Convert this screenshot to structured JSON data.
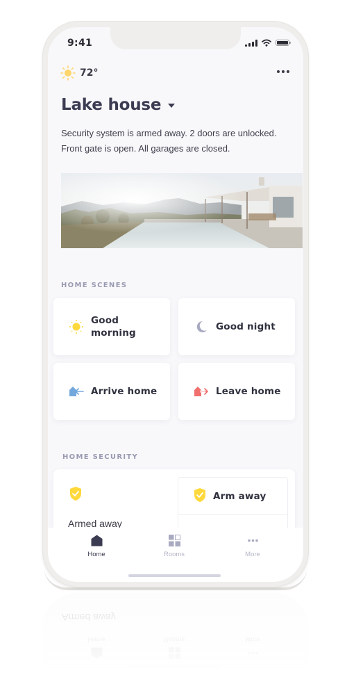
{
  "status_bar": {
    "time": "9:41",
    "icons": [
      "signal-icon",
      "wifi-icon",
      "battery-icon"
    ]
  },
  "weather": {
    "icon": "sun-icon",
    "temperature": "72°"
  },
  "header": {
    "more_icon": "more-horizontal-icon",
    "location": "Lake house",
    "location_dropdown_icon": "caret-down-icon"
  },
  "summary": "Security system is armed away. 2 doors are unlocked. Front gate is open. All garages are closed.",
  "hero_image": {
    "description": "Lake house with infinity pool and pergola overlooking hills"
  },
  "home_scenes": {
    "label": "HOME SCENES",
    "items": [
      {
        "label": "Good morning",
        "icon": "sun-icon",
        "color": "#ffd83b"
      },
      {
        "label": "Good night",
        "icon": "moon-icon",
        "color": "#a9aac2"
      },
      {
        "label": "Arrive home",
        "icon": "arrive-home-icon",
        "color": "#73a8dc"
      },
      {
        "label": "Leave home",
        "icon": "leave-home-icon",
        "color": "#f0706e"
      }
    ]
  },
  "home_security": {
    "label": "HOME SECURITY",
    "status": "Armed away",
    "status_icon": "shield-check-icon",
    "actions": [
      {
        "label": "Arm away",
        "icon": "shield-check-icon"
      }
    ]
  },
  "tab_bar": {
    "tabs": [
      {
        "label": "Home",
        "icon": "home-icon",
        "active": true
      },
      {
        "label": "Rooms",
        "icon": "rooms-grid-icon",
        "active": false
      },
      {
        "label": "More",
        "icon": "more-horizontal-icon",
        "active": false
      }
    ]
  },
  "colors": {
    "accent_dark": "#3b3c52",
    "shield_yellow": "#ffd83b",
    "inactive_tab": "#b4b5c6",
    "section_label": "#9a9bb2"
  }
}
